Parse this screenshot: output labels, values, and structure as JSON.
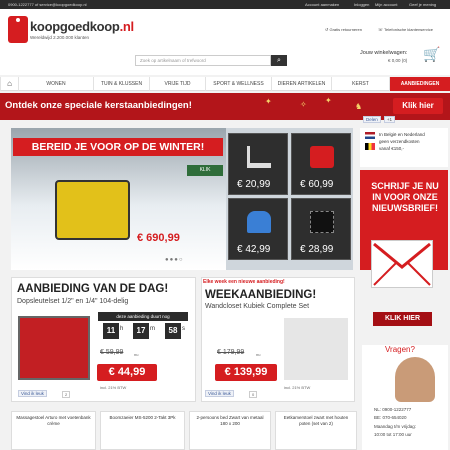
{
  "topbar": {
    "contact": "0900-1222777 of service@koopgoedkoop.nl",
    "account": "Account aanmaken",
    "login": "Inloggen",
    "myaccount": "Mijn account",
    "feedback": "Geef je mening"
  },
  "brand": {
    "name_a": "koopgoedkoop",
    "name_b": ".nl",
    "tagline": "Wereldwijd 2.200.000 klanten"
  },
  "usp": {
    "returns": "Gratis retourneren",
    "service": "Telefonische klantenservice"
  },
  "search": {
    "placeholder": "Zoek op artikelnaam of trefwoord"
  },
  "cart": {
    "title": "Jouw winkelwagen:",
    "value": "€ 0,00 (0)"
  },
  "nav": {
    "items": [
      "WONEN",
      "TUIN & KLUSSEN",
      "VRIJE TIJD",
      "SPORT & WELLNESS",
      "DIEREN ARTIKELEN",
      "KERST",
      "AANBIEDINGEN"
    ]
  },
  "xmas": {
    "text": "Ontdek onze speciale kerstaanbiedingen!",
    "button": "Klik hier"
  },
  "social": {
    "like": "Delen",
    "plus": "+1"
  },
  "hero": {
    "headline": "BEREID JE VOOR OP DE WINTER!",
    "main_price": "€ 690,99",
    "klik": "KLIK",
    "tiles": [
      "€ 20,99",
      "€ 60,99",
      "€ 42,99",
      "€ 28,99"
    ]
  },
  "shipping": {
    "line1": "In België en Nederland",
    "line2": "geen verzendkosten",
    "line3": "vanaf €150,-"
  },
  "newsletter": {
    "text": "SCHRIJF JE NU IN VOOR ONZE NIEUWSBRIEF!",
    "button": "KLIK HIER"
  },
  "deal": {
    "title": "AANBIEDING VAN DE DAG!",
    "product": "Dopsleutelset 1/2\" en 1/4\" 104-delig",
    "timer_label": "deze aanbieding duurt nog",
    "h": "11",
    "m": "17",
    "s": "58",
    "old_price": "€ 59,99",
    "old_suffix": "nu",
    "price": "€ 44,99",
    "vat": "incl. 21% BTW",
    "like": "Vind ik leuk",
    "count": "2"
  },
  "week": {
    "banner": "Elke week een nieuwe aanbieding!",
    "title": "WEEKAANBIEDING!",
    "product": "Wandcloset Kubiek Complete Set",
    "old_price": "€ 179,99",
    "old_suffix": "nu",
    "price": "€ 139,99",
    "vat": "incl. 21% BTW",
    "like": "Vind ik leuk",
    "count": "0"
  },
  "help": {
    "title": "Vragen?",
    "nl": "NL: 0900-1222777",
    "be": "BE: 070-654020",
    "hours1": "Maandag t/m vrijdag:",
    "hours2": "10:00 tot 17:00 uur"
  },
  "bottom": [
    "Massagestoel Arturo met voetenbank crème",
    "Boomzaeier MS-5200 2-Takt 3Pk",
    "2-persoons bed Zwart van metaal 180 x 200",
    "Eetkamerstoel zwart met houten poten (set van 2)"
  ]
}
